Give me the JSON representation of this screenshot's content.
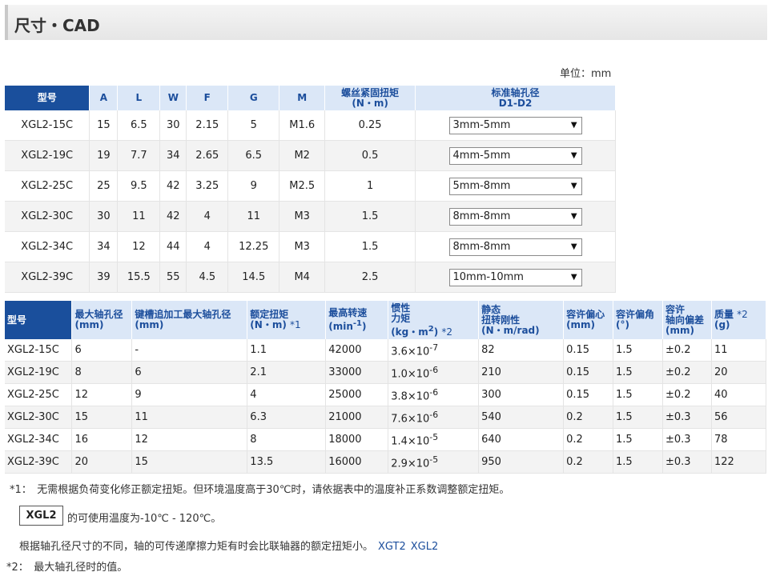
{
  "header": {
    "title": "尺寸・CAD"
  },
  "unit_label": "单位：mm",
  "table1": {
    "headers": [
      "型号",
      "A",
      "L",
      "W",
      "F",
      "G",
      "M",
      "螺丝紧固扭矩",
      "(N・m)",
      "标准轴孔径",
      "D1-D2"
    ],
    "rows": [
      [
        "XGL2-15C",
        "15",
        "6.5",
        "30",
        "2.15",
        "5",
        "M1.6",
        "0.25",
        "3mm-5mm"
      ],
      [
        "XGL2-19C",
        "19",
        "7.7",
        "34",
        "2.65",
        "6.5",
        "M2",
        "0.5",
        "4mm-5mm"
      ],
      [
        "XGL2-25C",
        "25",
        "9.5",
        "42",
        "3.25",
        "9",
        "M2.5",
        "1",
        "5mm-8mm"
      ],
      [
        "XGL2-30C",
        "30",
        "11",
        "42",
        "4",
        "11",
        "M3",
        "1.5",
        "8mm-8mm"
      ],
      [
        "XGL2-34C",
        "34",
        "12",
        "44",
        "4",
        "12.25",
        "M3",
        "1.5",
        "8mm-8mm"
      ],
      [
        "XGL2-39C",
        "39",
        "15.5",
        "55",
        "4.5",
        "14.5",
        "M4",
        "2.5",
        "10mm-10mm"
      ]
    ]
  },
  "table2": {
    "headers": {
      "model": "型号",
      "max_bore_1": "最大轴孔径",
      "max_bore_2": "(mm)",
      "keyway_1": "键槽追加工最大轴孔径",
      "keyway_2": "(mm)",
      "torque_1": "额定扭矩",
      "torque_2": "(N・m)",
      "torque_star": "*1",
      "speed_1": "最高转速",
      "speed_2": "(min",
      "speed_sup": "-1",
      "speed_3": ")",
      "inertia_1": "惯性",
      "inertia_2": "力矩",
      "inertia_3": "(kg・m",
      "inertia_sup": "2",
      "inertia_4": ")",
      "inertia_star": "*2",
      "stiff_1": "静态",
      "stiff_2": "扭转刚性",
      "stiff_3": "(N・m/rad)",
      "ecc_1": "容许偏心",
      "ecc_2": "(mm)",
      "ang_1": "容许偏角",
      "ang_2": "(°)",
      "axial_1": "容许",
      "axial_2": "轴向偏差",
      "axial_3": "(mm)",
      "mass_1": "质量",
      "mass_2": "(g)",
      "mass_star": "*2"
    },
    "rows": [
      [
        "XGL2-15C",
        "6",
        "-",
        "1.1",
        "42000",
        "3.6×10",
        "-7",
        "82",
        "0.15",
        "1.5",
        "±0.2",
        "11"
      ],
      [
        "XGL2-19C",
        "8",
        "6",
        "2.1",
        "33000",
        "1.0×10",
        "-6",
        "210",
        "0.15",
        "1.5",
        "±0.2",
        "20"
      ],
      [
        "XGL2-25C",
        "12",
        "9",
        "4",
        "25000",
        "3.8×10",
        "-6",
        "300",
        "0.15",
        "1.5",
        "±0.2",
        "40"
      ],
      [
        "XGL2-30C",
        "15",
        "11",
        "6.3",
        "21000",
        "7.6×10",
        "-6",
        "540",
        "0.2",
        "1.5",
        "±0.3",
        "56"
      ],
      [
        "XGL2-34C",
        "16",
        "12",
        "8",
        "18000",
        "1.4×10",
        "-5",
        "640",
        "0.2",
        "1.5",
        "±0.3",
        "78"
      ],
      [
        "XGL2-39C",
        "20",
        "15",
        "13.5",
        "16000",
        "2.9×10",
        "-5",
        "950",
        "0.2",
        "1.5",
        "±0.3",
        "122"
      ]
    ]
  },
  "notes": {
    "n1": "*1：　无需根据负荷变化修正额定扭矩。但环境温度高于30℃时，请依据表中的温度补正系数调整额定扭矩。",
    "box": "XGL2",
    "temp": "的可使用温度为-10℃ - 120℃。",
    "bore": "根据轴孔径尺寸的不同，轴的可传递摩擦力矩有时会比联轴器的额定扭矩小。",
    "link1": "XGT2",
    "link2": "XGL2",
    "n2": "*2：　最大轴孔径时的值。"
  }
}
